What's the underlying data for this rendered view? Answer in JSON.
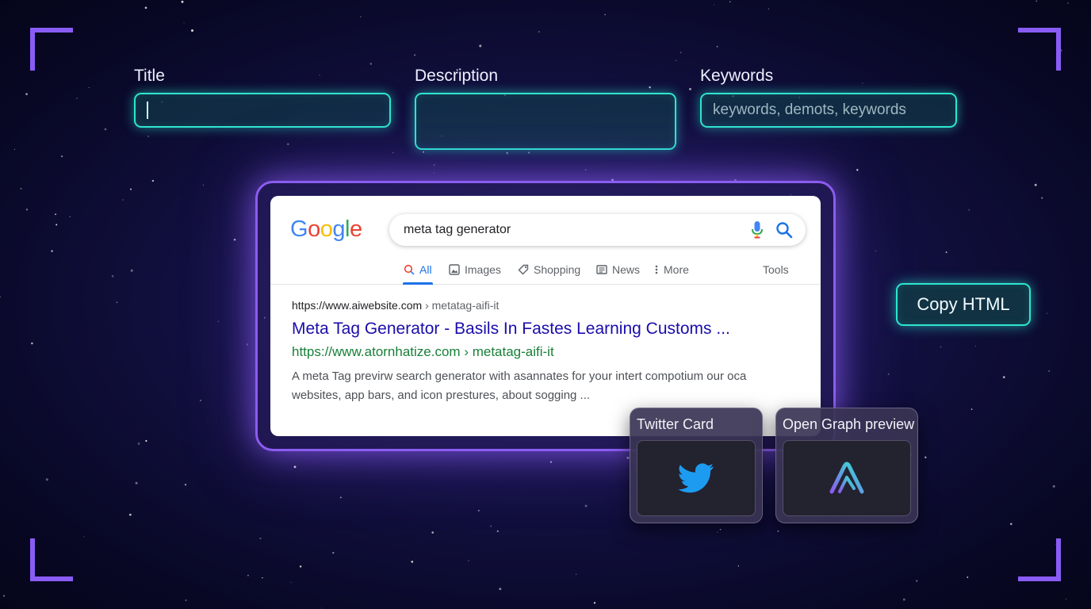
{
  "form": {
    "title_label": "Title",
    "title_value": "",
    "description_label": "Description",
    "description_value": "",
    "keywords_label": "Keywords",
    "keywords_placeholder": "keywords, demots, keywords"
  },
  "serp": {
    "logo_letters": [
      "G",
      "o",
      "o",
      "g",
      "l",
      "e"
    ],
    "logo_colors": [
      "#4285F4",
      "#EA4335",
      "#FBBC05",
      "#4285F4",
      "#34A853",
      "#EA4335"
    ],
    "query": "meta tag generator",
    "tabs": [
      {
        "label": "All",
        "icon": "search-icon",
        "active": true
      },
      {
        "label": "Images",
        "icon": "image-icon",
        "active": false
      },
      {
        "label": "Shopping",
        "icon": "tag-icon",
        "active": false
      },
      {
        "label": "News",
        "icon": "newspaper-icon",
        "active": false
      },
      {
        "label": "More",
        "icon": "more-vertical-icon",
        "active": false
      }
    ],
    "tools_label": "Tools",
    "result": {
      "url": "https://www.aiwebsite.com",
      "breadcrumb": "› metatag-aifi-it",
      "title": "Meta Tag Generator - Basils In Fastes Learning Customs ...",
      "green_url": "https://www.atornhatize.com › metatag-aifi-it",
      "description": "A meta Tag previrw search generator with asannates for your intert compotium our oca websites, app bars, and icon prestures, about sogging ..."
    }
  },
  "cards": {
    "twitter_title": "Twitter Card",
    "twitter_icon": "twitter-bird-icon",
    "og_title": "Open Graph preview",
    "og_icon": "open-graph-logo-icon"
  },
  "actions": {
    "copy_label": "Copy HTML"
  },
  "colors": {
    "accent_cyan": "#2ee6d0",
    "accent_purple": "#8c5cf0",
    "twitter_blue": "#1d9bf0",
    "link_blue": "#1a0dab",
    "url_green": "#188038"
  }
}
